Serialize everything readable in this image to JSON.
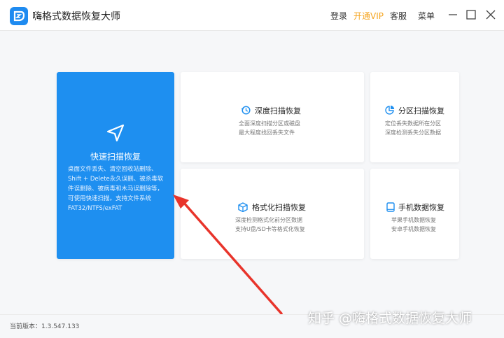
{
  "app": {
    "title": "嗨格式数据恢复大师"
  },
  "menu": {
    "login": "登录",
    "vip": "开通VIP",
    "service": "客服",
    "menu": "菜单"
  },
  "cards": {
    "quick": {
      "title": "快速扫描恢复",
      "desc": [
        "桌面文件丢失、清空回收站删除、",
        "Shift + Delete永久误删、被杀毒软",
        "件误删除、被病毒和木马误删除等，",
        "可使用快速扫描。支持文件系统",
        "FAT32/NTFS/exFAT"
      ]
    },
    "deep": {
      "title": "深度扫描恢复",
      "desc": [
        "全面深度扫描分区或磁盘",
        "最大程度找回丢失文件"
      ]
    },
    "partition": {
      "title": "分区扫描恢复",
      "desc": [
        "定位丢失数据所在分区",
        "深度检测丢失分区数据"
      ]
    },
    "format": {
      "title": "格式化扫描恢复",
      "desc": [
        "深度检测格式化前分区数据",
        "支持U盘/SD卡等格式化恢复"
      ]
    },
    "phone": {
      "title": "手机数据恢复",
      "desc": [
        "苹果手机数据恢复",
        "安卓手机数据恢复"
      ]
    }
  },
  "footer": {
    "version": "当前版本：1.3.547.133"
  },
  "watermark": "知乎 @嗨格式数据恢复大师",
  "colors": {
    "accent": "#1e8ff0",
    "vip": "#f5a623",
    "arrow": "#e8342b"
  }
}
